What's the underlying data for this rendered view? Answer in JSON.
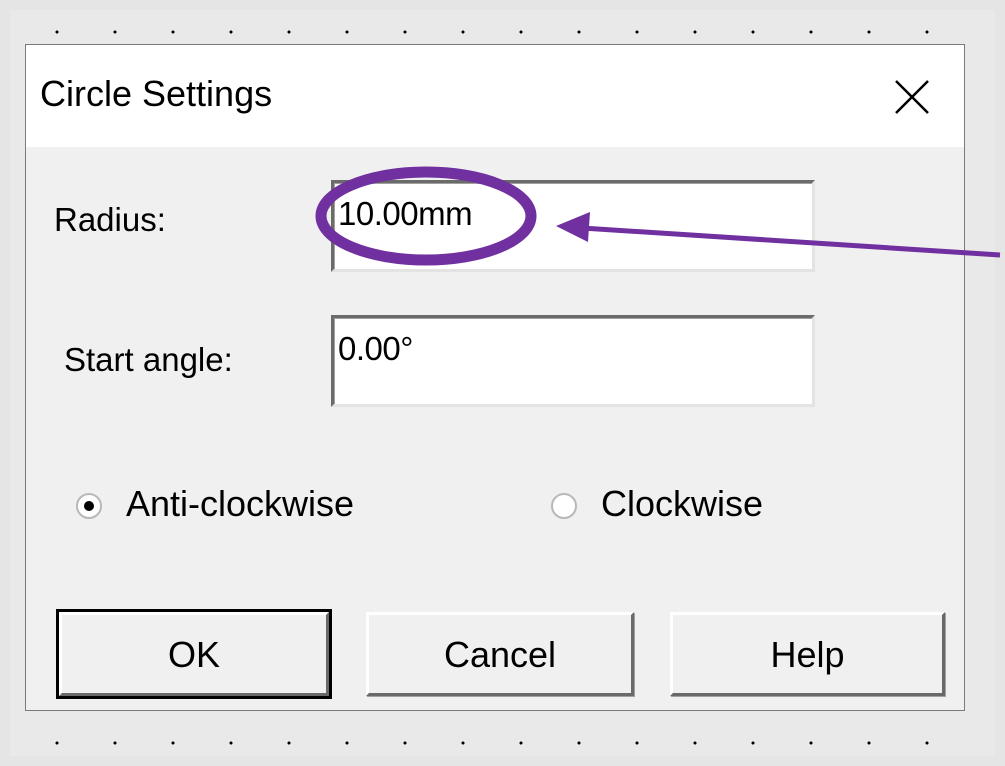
{
  "dialog": {
    "title": "Circle Settings",
    "close_icon": "close-x-icon"
  },
  "radius": {
    "label": "Radius:",
    "value": "10.00mm"
  },
  "start_angle": {
    "label": "Start angle:",
    "value": "0.00°"
  },
  "direction": {
    "options": [
      {
        "label": "Anti-clockwise",
        "selected": true
      },
      {
        "label": "Clockwise",
        "selected": false
      }
    ]
  },
  "buttons": {
    "ok": "OK",
    "cancel": "Cancel",
    "help": "Help"
  },
  "annotation": {
    "highlight_color": "#7030a0",
    "target": "radius-value"
  }
}
